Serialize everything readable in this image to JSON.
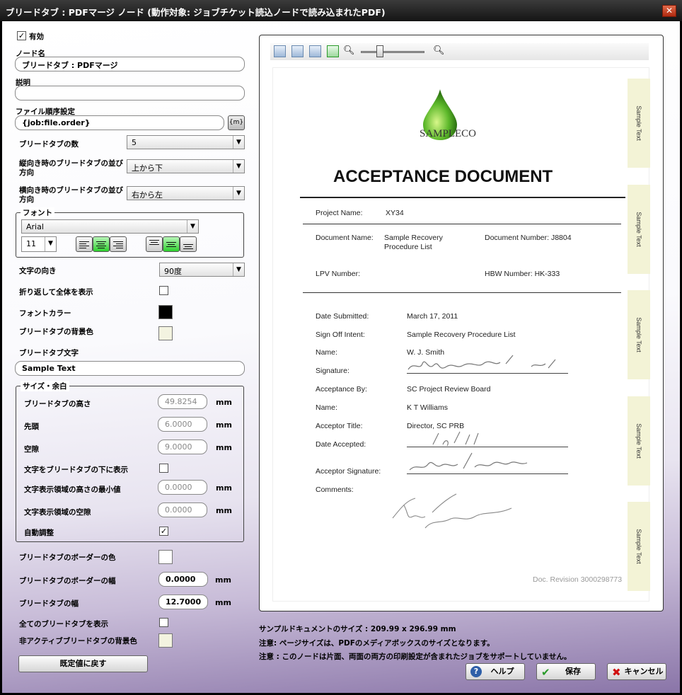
{
  "window": {
    "title": "ブリードタブ : PDFマージ ノード (動作対象: ジョブチケット読込ノードで読み込まれたPDF)",
    "close_label": "✕"
  },
  "form": {
    "enabled_label": "有効",
    "enabled": true,
    "node_name_label": "ノード名",
    "node_name_value": "ブリードタブ : PDFマージ",
    "description_label": "説明",
    "description_value": "",
    "file_order_label": "ファイル順序設定",
    "file_order_value": "{job:file.order}",
    "tab_count_label": "ブリードタブの数",
    "tab_count_value": "5",
    "portrait_order_label": "縦向き時のブリードタブの並び方向",
    "portrait_order_line1": "縦向き時のブリードタブの並び",
    "portrait_order_line2": "方向",
    "portrait_order_value": "上から下",
    "landscape_order_line1": "横向き時のブリードタブの並び",
    "landscape_order_line2": "方向",
    "landscape_order_value": "右から左",
    "font_group_label": "フォント",
    "font_name": "Arial",
    "font_size": "11",
    "text_direction_label": "文字の向き",
    "text_direction_value": "90度",
    "wrap_label": "折り返して全体を表示",
    "wrap": false,
    "font_color_label": "フォントカラー",
    "font_color": "#000000",
    "tab_bg_label": "ブリードタブの背景色",
    "tab_bg_color": "#f3f3e0",
    "tab_text_label": "ブリードタブ文字",
    "tab_text_value": "Sample Text",
    "size_group_label": "サイズ・余白",
    "tab_height_label": "ブリードタブの高さ",
    "tab_height_value": "49.8254",
    "leading_label": "先頭",
    "leading_value": "6.0000",
    "gap_label": "空隙",
    "gap_value": "9.0000",
    "text_below_label": "文字をブリードタブの下に表示",
    "text_below": false,
    "min_text_height_label": "文字表示領域の高さの最小値",
    "min_text_height_value": "0.0000",
    "text_gap_label": "文字表示領域の空隙",
    "text_gap_value": "0.0000",
    "auto_adjust_label": "自動調整",
    "auto_adjust": true,
    "border_color_label": "ブリードタブのボーダーの色",
    "border_color": "#ffffff",
    "border_width_label": "ブリードタブのボーダーの幅",
    "border_width_value": "0.0000",
    "tab_width_label": "ブリードタブの幅",
    "tab_width_value": "12.7000",
    "show_all_label": "全てのブリードタブを表示",
    "show_all": false,
    "inactive_bg_label": "非アクティブブリードタブの背景色",
    "inactive_bg_color": "#f3f3e0",
    "unit": "mm",
    "reset_label": "既定値に戻す"
  },
  "preview": {
    "zoom_percent": 30,
    "company": "SAMPLECO",
    "doc_title": "ACCEPTANCE DOCUMENT",
    "project_name_label": "Project Name:",
    "project_name": "XY34",
    "doc_name_label": "Document Name:",
    "doc_name_1": "Sample Recovery",
    "doc_name_2": "Procedure List",
    "doc_number": "Document Number: J8804",
    "lpv_label": "LPV Number:",
    "hbw": "HBW Number: HK-333",
    "date_submitted_label": "Date Submitted:",
    "date_submitted": "March 17, 2011",
    "sign_off_label": "Sign Off Intent:",
    "sign_off": "Sample Recovery Procedure List",
    "name1_label": "Name:",
    "name1": "W. J. Smith",
    "signature_label": "Signature:",
    "acceptance_by_label": "Acceptance By:",
    "acceptance_by": "SC Project Review Board",
    "name2_label": "Name:",
    "name2": "K T Williams",
    "acceptor_title_label": "Acceptor Title:",
    "acceptor_title": "Director, SC PRB",
    "date_accepted_label": "Date Accepted:",
    "acceptor_signature_label": "Acceptor Signature:",
    "comments_label": "Comments:",
    "revision": "Doc. Revision 3000298773",
    "tab_text": "Sample Text"
  },
  "footer": {
    "doc_size": "サンプルドキュメントのサイズ :  209.99 x 296.99 mm",
    "note1": "注意: ページサイズは、PDFのメディアボックスのサイズとなります。",
    "note2": "注意 : このノードは片面、両面の両方の印刷設定が含まれたジョブをサポートしていません。",
    "help_label": "ヘルプ",
    "save_label": "保存",
    "cancel_label": "キャンセル"
  }
}
